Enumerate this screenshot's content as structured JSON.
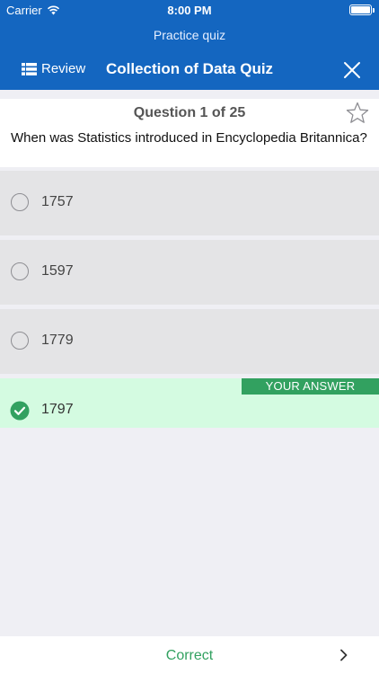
{
  "status_bar": {
    "carrier": "Carrier",
    "time": "8:00 PM"
  },
  "header": {
    "subtitle": "Practice quiz",
    "review_label": "Review",
    "title": "Collection of Data Quiz"
  },
  "question": {
    "counter": "Question 1 of 25",
    "text": "When was Statistics introduced in Encyclopedia Britannica?"
  },
  "options": [
    {
      "label": "1757",
      "selected": false
    },
    {
      "label": "1597",
      "selected": false
    },
    {
      "label": "1779",
      "selected": false
    },
    {
      "label": "1797",
      "selected": true
    }
  ],
  "your_answer_badge": "YOUR ANSWER",
  "footer": {
    "result": "Correct"
  },
  "colors": {
    "header": "#1466c0",
    "correct": "#32a160",
    "selected_bg": "#d4fbe1",
    "option_bg": "#e4e4e6"
  },
  "icons": [
    "wifi-icon",
    "battery-icon",
    "list-icon",
    "close-icon",
    "star-icon",
    "radio-icon",
    "checkmark-circle-icon",
    "chevron-right-icon"
  ]
}
